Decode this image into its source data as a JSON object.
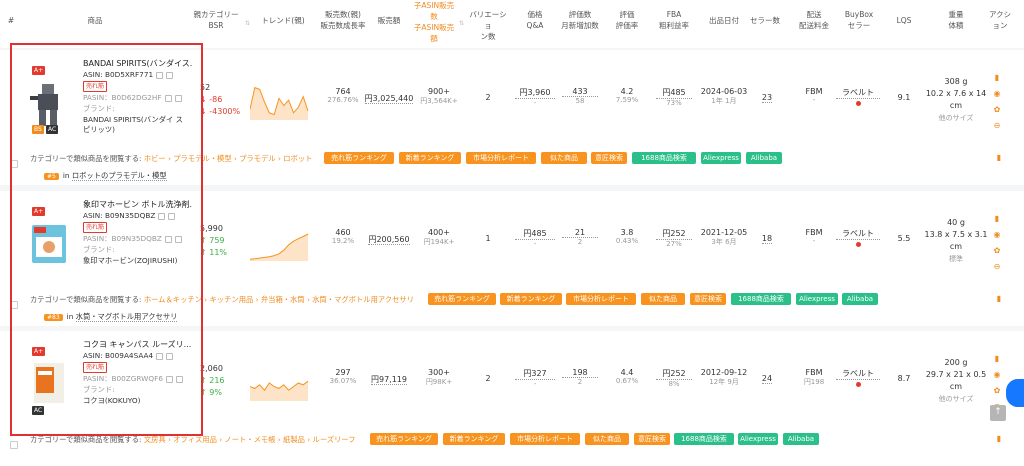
{
  "header": {
    "col_index": "#",
    "col_product": "商品",
    "col_bsr": [
      "親カテゴリー",
      "BSR"
    ],
    "col_trend": "トレンド(親)",
    "col_sales": [
      "販売数(親)",
      "販売数成長率"
    ],
    "col_revenue": "販売額",
    "col_child": [
      "子ASIN販売",
      "数",
      "子ASIN販売",
      "額"
    ],
    "col_variation": [
      "バリエーショ",
      "ン数"
    ],
    "col_price": [
      "価格",
      "Q&A"
    ],
    "col_reviews": [
      "評価数",
      "月新増加数"
    ],
    "col_rating": [
      "評価",
      "評価率"
    ],
    "col_fba": [
      "FBA",
      "粗利益率"
    ],
    "col_date": "出品日付",
    "col_sellers": "セラー数",
    "col_ship": [
      "配送",
      "配送料金"
    ],
    "col_buybox": [
      "BuyBox",
      "セラー"
    ],
    "col_lqs": "LQS",
    "col_weight": [
      "重量",
      "体積"
    ],
    "col_action": [
      "アクシ",
      "ョン"
    ]
  },
  "products": [
    {
      "title": "BANDAI SPIRITS(バンダイス...",
      "asin": "ASIN: B0D5XRF771",
      "badge_bestseller": "売れ筋",
      "pasin": "PASIN：B0D62DG2HF",
      "brand_label": "ブランド:",
      "brand": "BANDAI SPIRITS(バンダイ ス",
      "brand2": "ピリッツ)",
      "badge_aplus": "A+",
      "badge_bs": "BS",
      "badge_ac": "AC",
      "bsr": "52",
      "bsr_change": "↓ -86",
      "bsr_pct": "↓ -4300%",
      "sales": "764",
      "sales_growth": "276.76%",
      "revenue": "円3,025,440",
      "child_sales": "900+",
      "child_revenue": "円3,564K+",
      "variations": "2",
      "price": "円3,960",
      "qa": "-",
      "reviews": "433",
      "reviews_new": "58",
      "rating": "4.2",
      "rating_rate": "7.59%",
      "fba": "円485",
      "margin": "73%",
      "date": "2024-06-03",
      "age": "1年 1月",
      "sellers": "23",
      "ship": "FBM",
      "ship_fee": "-",
      "buybox": "ラベルト",
      "lqs": "9.1",
      "weight": "308 g",
      "volume": "10.2 x 7.6 x 14",
      "volume2": "cm",
      "size_note": "他のサイズ",
      "category_prefix": "カテゴリーで類似商品を閲覧する:",
      "category_path": "ホビー › プラモデル・模型 › プラモデル › ロボット",
      "rank_badge": "#5",
      "rank_in": "in",
      "rank_cat": "ロボットのプラモデル・模型",
      "trend": [
        0.3,
        0.9,
        0.85,
        0.5,
        0.2,
        0.15,
        0.6,
        0.4,
        0.55,
        0.2,
        0.35,
        0.65,
        0.25
      ]
    },
    {
      "title": "象印マホービン ボトル洗浄剤...",
      "asin": "ASIN: B09N35DQBZ",
      "badge_bestseller": "売れ筋",
      "pasin": "PASIN：B09N35DQBZ",
      "brand_label": "ブランド:",
      "brand": "象印マホービン(ZOJIRUSHI)",
      "brand2": "",
      "badge_aplus": "A+",
      "badge_bs": "",
      "badge_ac": "",
      "bsr": "5,990",
      "bsr_change": "↑ 759",
      "bsr_pct": "↑ 11%",
      "sales": "460",
      "sales_growth": "19.2%",
      "revenue": "円200,560",
      "child_sales": "400+",
      "child_revenue": "円194K+",
      "variations": "1",
      "price": "円485",
      "qa": "-",
      "reviews": "21",
      "reviews_new": "2",
      "rating": "3.8",
      "rating_rate": "0.43%",
      "fba": "円252",
      "margin": "27%",
      "date": "2021-12-05",
      "age": "3年 6月",
      "sellers": "18",
      "ship": "FBM",
      "ship_fee": "-",
      "buybox": "ラベルト",
      "lqs": "5.5",
      "weight": "40 g",
      "volume": "13.8 x 7.5 x 3.1",
      "volume2": "cm",
      "size_note": "標準",
      "category_prefix": "カテゴリーで類似商品を閲覧する:",
      "category_path": "ホーム＆キッチン › キッチン用品 › 弁当箱・水筒 › 水筒・マグボトル用アクセサリ",
      "rank_badge": "#83",
      "rank_in": "in",
      "rank_cat": "水筒・マグボトル用アクセサリ",
      "trend": [
        0.05,
        0.06,
        0.08,
        0.1,
        0.12,
        0.15,
        0.2,
        0.3,
        0.45,
        0.55,
        0.62,
        0.68,
        0.75
      ]
    },
    {
      "title": "コクヨ キャンパス ルーズリ...",
      "asin": "ASIN: B009A4SAA4",
      "badge_bestseller": "売れ筋",
      "pasin": "PASIN：B00ZGRWQF6",
      "brand_label": "ブランド:",
      "brand": "コクヨ(KOKUYO)",
      "brand2": "",
      "badge_aplus": "A+",
      "badge_bs": "",
      "badge_ac": "AC",
      "bsr": "2,060",
      "bsr_change": "↑ 216",
      "bsr_pct": "↑ 9%",
      "sales": "297",
      "sales_growth": "36.07%",
      "revenue": "円97,119",
      "child_sales": "300+",
      "child_revenue": "円98K+",
      "variations": "2",
      "price": "円327",
      "qa": "-",
      "reviews": "198",
      "reviews_new": "2",
      "rating": "4.4",
      "rating_rate": "0.67%",
      "fba": "円252",
      "margin": "8%",
      "date": "2012-09-12",
      "age": "12年 9月",
      "sellers": "24",
      "ship": "FBM",
      "ship_fee": "円198",
      "buybox": "ラベルト",
      "lqs": "8.7",
      "weight": "200 g",
      "volume": "29.7 x 21 x 0.5",
      "volume2": "cm",
      "size_note": "他のサイズ",
      "category_prefix": "カテゴリーで類似商品を閲覧する:",
      "category_path": "文房具 › オフィス用品 › ノート・メモ帳 › 紙製品 › ルーズリーフ",
      "rank_badge": "",
      "rank_in": "",
      "rank_cat": "",
      "trend": [
        0.4,
        0.35,
        0.45,
        0.3,
        0.5,
        0.4,
        0.35,
        0.45,
        0.3,
        0.4,
        0.5,
        0.45,
        0.55
      ]
    }
  ],
  "tags": [
    "売れ筋ランキング",
    "新着ランキング",
    "市場分析レポート",
    "似た商品",
    "意匠検索",
    "1688商品検索",
    "Aliexpress",
    "Alibaba"
  ],
  "top_button": "↑"
}
